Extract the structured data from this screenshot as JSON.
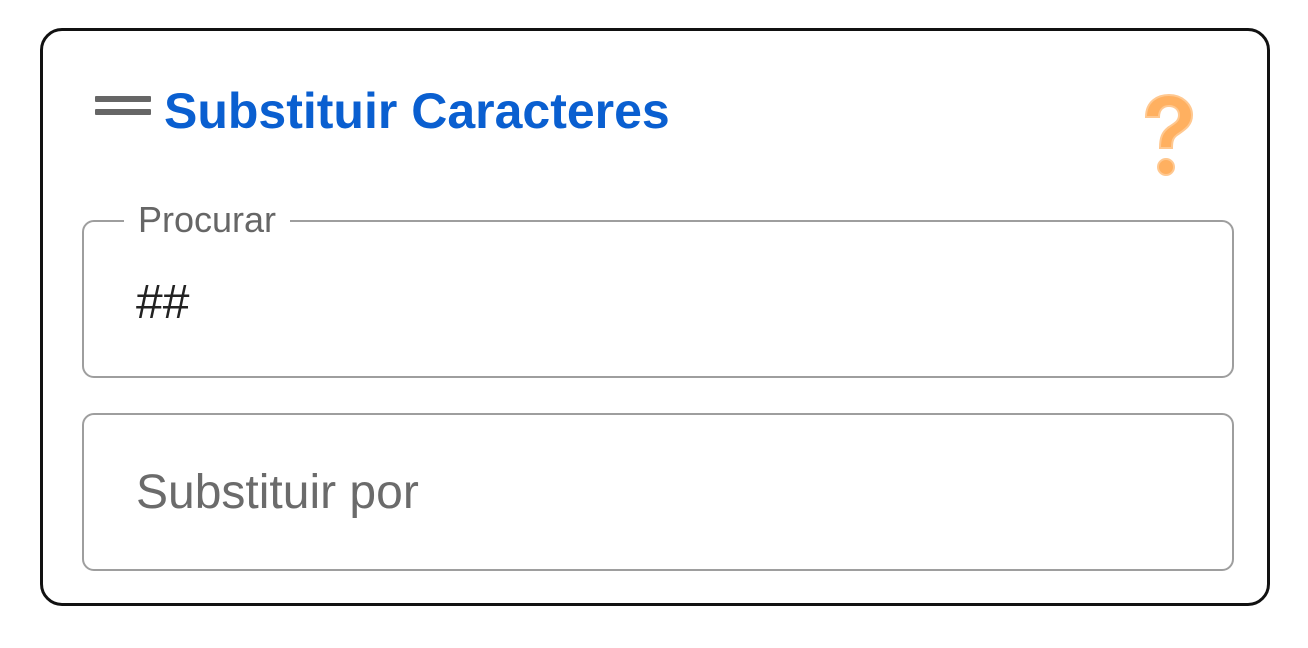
{
  "panel": {
    "title": "Substituir Caracteres",
    "help_icon": "question-mark-icon",
    "drag_icon": "drag-handle-icon",
    "colors": {
      "title": "#0a5fd0",
      "help": "#ffb060",
      "border": "#111111",
      "field_border": "#9e9e9e"
    }
  },
  "search_field": {
    "label": "Procurar",
    "value": "##"
  },
  "replace_field": {
    "placeholder": "Substituir por",
    "value": ""
  }
}
